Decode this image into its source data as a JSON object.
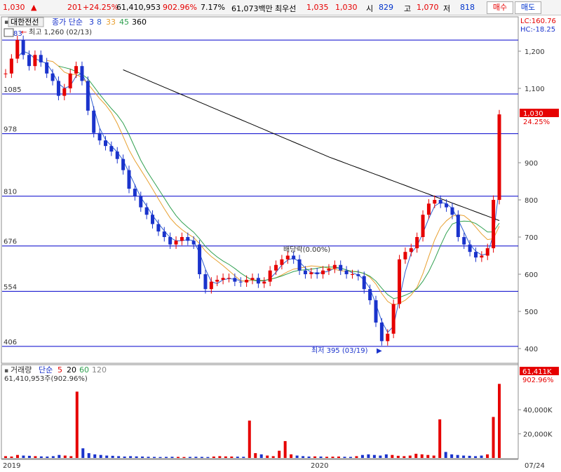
{
  "header": {
    "price": "1,030",
    "change": "201",
    "change_pct": "+24.25%",
    "volume": "61,410,953",
    "volume_ratio": "902.96%",
    "turnover_rate": "7.17%",
    "amount": "61,073백만",
    "best_ask_label": "최우선",
    "best_ask": "1,035",
    "best_bid": "1,030",
    "open_label": "시",
    "open": "829",
    "high_label": "고",
    "high": "1,070",
    "low_label": "저",
    "low": "818",
    "buy_button": "매수",
    "sell_button": "매도"
  },
  "colors": {
    "up": "#e60000",
    "down": "#1a33cc",
    "ma3": "#2f5fd0",
    "ma8": "#e8a030",
    "ma33": "#30a050",
    "ma45": "#e8a030",
    "ma360": "#000000",
    "hline": "#0000cc"
  },
  "chart_data": [
    {
      "type": "candlestick",
      "legend": {
        "stock": "대한전선",
        "label": "종가 단순",
        "periods": [
          "3",
          "8",
          "33",
          "45",
          "360"
        ]
      },
      "y_ticks": [
        "1,200",
        "1,100",
        "900",
        "800",
        "700",
        "600",
        "500",
        "400"
      ],
      "ylim": [
        380,
        1290
      ],
      "x_labels": [
        "2019",
        "2020",
        "07/24"
      ],
      "right_info": {
        "lc": "LC:160.76",
        "hc": "HC:-18.25"
      },
      "price_tag": {
        "price": "1,030",
        "pct": "24.25%"
      },
      "hlines": [
        {
          "value": 1230,
          "label": ""
        },
        {
          "value": 1085,
          "label": "1085"
        },
        {
          "value": 978,
          "label": "978"
        },
        {
          "value": 810,
          "label": "810"
        },
        {
          "value": 676,
          "label": "676"
        },
        {
          "value": 554,
          "label": "554"
        },
        {
          "value": 406,
          "label": "406"
        }
      ],
      "annotations": {
        "high": "최고 1,260 (02/13)",
        "low": "최저 395 (03/19)",
        "dividend": "배당락(0.00%)",
        "left_cut": "83"
      },
      "close_series": [
        1140,
        1180,
        1230,
        1190,
        1160,
        1190,
        1170,
        1140,
        1120,
        1080,
        1100,
        1140,
        1160,
        1120,
        1040,
        980,
        960,
        945,
        930,
        910,
        880,
        830,
        810,
        780,
        760,
        735,
        715,
        700,
        680,
        690,
        700,
        690,
        680,
        600,
        560,
        580,
        585,
        590,
        590,
        580,
        578,
        585,
        590,
        575,
        580,
        610,
        625,
        640,
        650,
        640,
        610,
        600,
        605,
        600,
        610,
        615,
        625,
        610,
        600,
        600,
        595,
        560,
        530,
        470,
        420,
        440,
        520,
        640,
        660,
        670,
        700,
        760,
        790,
        800,
        790,
        780,
        760,
        700,
        680,
        660,
        645,
        650,
        670,
        800,
        1030
      ]
    },
    {
      "type": "bar",
      "legend": {
        "label": "거래량",
        "ma_label": "단순",
        "periods": [
          "5",
          "20",
          "60",
          "120"
        ]
      },
      "info": "61,410,953주(902.96%)",
      "y_ticks": [
        "40,000K",
        "20,000K"
      ],
      "ylim": [
        0,
        64000
      ],
      "tag": {
        "value": "61,411K",
        "pct": "902.96%"
      },
      "volume_series": [
        1500,
        1200,
        2500,
        2000,
        1800,
        1500,
        1300,
        1200,
        1500,
        2500,
        2000,
        1500,
        55000,
        8000,
        4000,
        3000,
        2500,
        2000,
        1800,
        1500,
        1200,
        1500,
        1300,
        1200,
        1000,
        900,
        800,
        900,
        1000,
        900,
        800,
        900,
        1000,
        900,
        800,
        1200,
        1500,
        1300,
        1200,
        1100,
        1000,
        31000,
        4000,
        3000,
        2000,
        1500,
        6000,
        14000,
        3000,
        2000,
        1500,
        1200,
        1300,
        1200,
        1000,
        1100,
        1200,
        1000,
        900,
        1500,
        2500,
        3000,
        2500,
        2000,
        3000,
        2500,
        1800,
        1500,
        2000,
        3500,
        3000,
        2500,
        2000,
        32000,
        5000,
        3000,
        2500,
        2000,
        1800,
        1500,
        2000,
        3000,
        34000,
        61411
      ]
    }
  ]
}
